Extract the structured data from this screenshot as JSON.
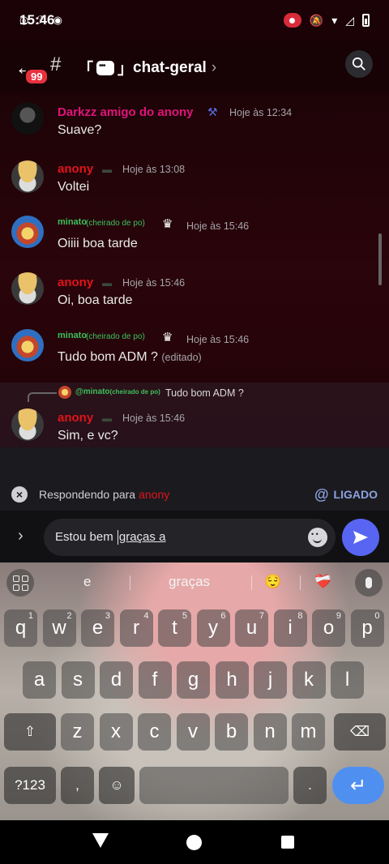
{
  "status_bar": {
    "time": "15:46",
    "icons": [
      "whatsapp-icon",
      "f-icon",
      "rec-icon",
      "screen-record-icon",
      "mute-icon",
      "wifi-icon",
      "signal-icon",
      "battery-icon"
    ]
  },
  "header": {
    "unread_badge": "99",
    "channel_prefix": "#",
    "channel_bracket_open": "「",
    "channel_bracket_close": "」",
    "channel_name": "chat-geral",
    "chevron": "›"
  },
  "messages": [
    {
      "author": "Darkzz amigo do anony",
      "author_color": "#e0147a",
      "time": "Hoje às 12:34",
      "text": "Suave?",
      "avatar": "dark"
    },
    {
      "author": "anony",
      "author_color": "#e0141c",
      "time": "Hoje às 13:08",
      "text": "Voltei",
      "avatar": "straw"
    },
    {
      "author": "minato",
      "author_tag": "(cheirado de po)",
      "author_color": "#3cc05b",
      "time": "Hoje às 15:46",
      "text": "Oiiii boa tarde",
      "avatar": "minato"
    },
    {
      "author": "anony",
      "author_color": "#e0141c",
      "time": "Hoje às 15:46",
      "text": "Oi, boa tarde",
      "avatar": "straw"
    },
    {
      "author": "minato",
      "author_tag": "(cheirado de po)",
      "author_color": "#3cc05b",
      "time": "Hoje às 15:46",
      "text": "Tudo bom ADM ?",
      "edited": "(editado)",
      "avatar": "minato"
    },
    {
      "author": "anony",
      "author_color": "#e0141c",
      "time": "Hoje às 15:46",
      "text": "Sim, e vc?",
      "avatar": "straw",
      "reply_to": {
        "author": "@minato",
        "author_tag": "(cheirado de po)",
        "text": "Tudo bom ADM ?"
      }
    }
  ],
  "reply_bar": {
    "label": "Respondendo para",
    "target": "anony",
    "mention_label": "LIGADO",
    "mention_symbol": "@"
  },
  "composer": {
    "text_before_caret": "Estou bem ",
    "text_after_caret": "graças a",
    "expand_symbol": "›"
  },
  "keyboard": {
    "suggestions": [
      "e",
      "graças",
      "😌",
      "❤️‍🩹"
    ],
    "row1": [
      [
        "q",
        "1"
      ],
      [
        "w",
        "2"
      ],
      [
        "e",
        "3"
      ],
      [
        "r",
        "4"
      ],
      [
        "t",
        "5"
      ],
      [
        "y",
        "6"
      ],
      [
        "u",
        "7"
      ],
      [
        "i",
        "8"
      ],
      [
        "o",
        "9"
      ],
      [
        "p",
        "0"
      ]
    ],
    "row2": [
      "a",
      "s",
      "d",
      "f",
      "g",
      "h",
      "j",
      "k",
      "l"
    ],
    "row3": [
      "z",
      "x",
      "c",
      "v",
      "b",
      "n",
      "m"
    ],
    "symbols_key": "?123",
    "comma_key": ",",
    "period_key": ".",
    "enter_symbol": "↵"
  },
  "colors": {
    "accent_send": "#5865f2",
    "mention_blue": "#8ea1e1",
    "enter_key": "#4f8ff0",
    "badge_red": "#e8313f"
  }
}
